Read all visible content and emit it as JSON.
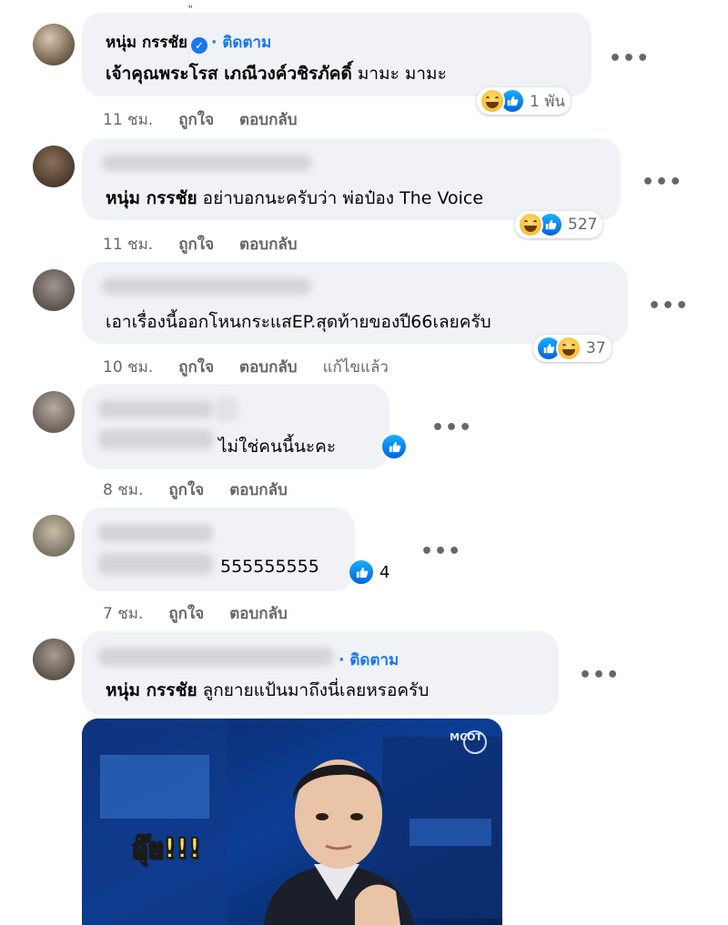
{
  "comments": [
    {
      "author": "หนุ่ม กรรชัย",
      "verified": true,
      "follow": "· ติดตาม",
      "text_bold": "เจ้าคุณพระโรส เภณีวงค์วชิรภัคดิ์",
      "text": "มามะ มามะ",
      "reactions_count": "1 พัน",
      "time": "11 ชม.",
      "like": "ถูกใจ",
      "reply": "ตอบกลับ"
    },
    {
      "text_bold": "หนุ่ม กรรชัย",
      "text": "อย่าบอกนะครับว่า พ่อป๋อง The Voice",
      "reactions_count": "527",
      "time": "11 ชม.",
      "like": "ถูกใจ",
      "reply": "ตอบกลับ"
    },
    {
      "text": "เอาเรื่องนี้ออกโหนกระแสEP.สุดท้ายของปี66เลยครับ",
      "reactions_count": "37",
      "time": "10 ชม.",
      "like": "ถูกใจ",
      "reply": "ตอบกลับ",
      "edited": "แก้ไขแล้ว"
    },
    {
      "text": "ไม่ใช่คนนี้นะคะ",
      "time": "8 ชม.",
      "like": "ถูกใจ",
      "reply": "ตอบกลับ"
    },
    {
      "text": "555555555",
      "reactions_count": "4",
      "time": "7 ชม.",
      "like": "ถูกใจ",
      "reply": "ตอบกลับ"
    },
    {
      "follow": "· ติดตาม",
      "text_bold": "หนุ่ม กรรชัย",
      "text": "ลูกยายแป้นมาถึงนี่เลยหรอครับ"
    }
  ],
  "more_label": "•••",
  "gif": {
    "caption": "อุ๊ย!!!",
    "logo_text": "MCOT"
  },
  "colors": {
    "bubble": "#f0f2f5",
    "link_blue": "#1877f2",
    "meta_gray": "#65676b"
  }
}
